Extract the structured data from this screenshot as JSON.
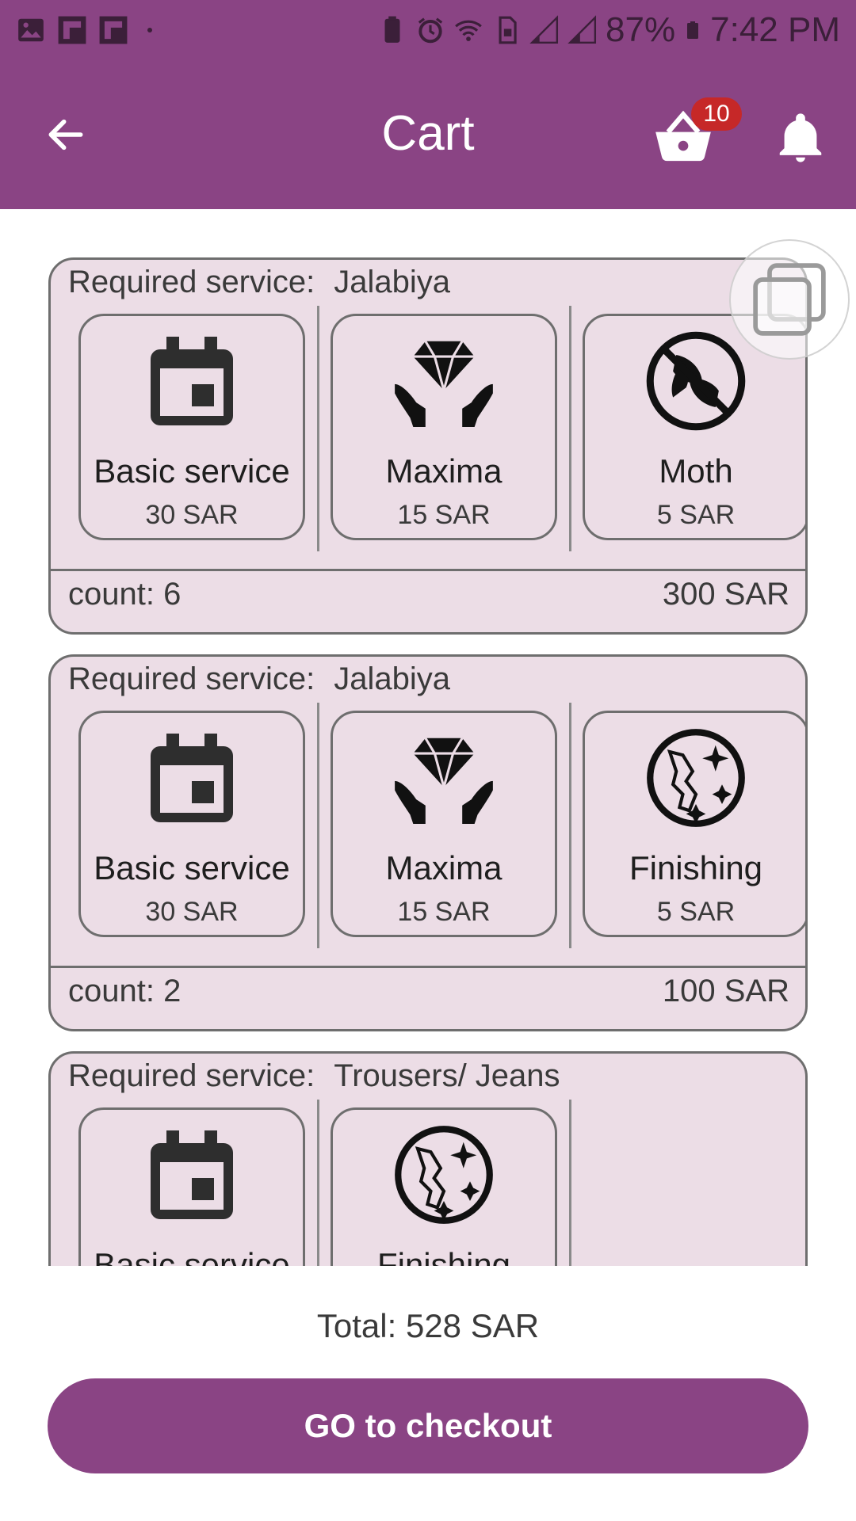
{
  "status_bar": {
    "battery_percent": "87%",
    "time": "7:42 PM"
  },
  "app_bar": {
    "title": "Cart",
    "cart_badge": "10"
  },
  "cart_items": [
    {
      "label": "Required service:",
      "service_name": "Jalabiya",
      "options": [
        {
          "icon": "calendar-icon",
          "name": "Basic service",
          "price": "30 SAR"
        },
        {
          "icon": "diamond-hands-icon",
          "name": "Maxima",
          "price": "15 SAR"
        },
        {
          "icon": "no-moth-icon",
          "name": "Moth",
          "price": "5 SAR"
        }
      ],
      "count": "count: 6",
      "total": "300 SAR"
    },
    {
      "label": "Required service:",
      "service_name": "Jalabiya",
      "options": [
        {
          "icon": "calendar-icon",
          "name": "Basic service",
          "price": "30 SAR"
        },
        {
          "icon": "diamond-hands-icon",
          "name": "Maxima",
          "price": "15 SAR"
        },
        {
          "icon": "sparkle-finishing-icon",
          "name": "Finishing",
          "price": "5 SAR"
        }
      ],
      "count": "count: 2",
      "total": "100 SAR"
    },
    {
      "label": "Required service:",
      "service_name": "Trousers/ Jeans",
      "options": [
        {
          "icon": "calendar-icon",
          "name": "Basic service",
          "price": ""
        },
        {
          "icon": "sparkle-finishing-icon",
          "name": "Finishing",
          "price": ""
        }
      ]
    }
  ],
  "footer": {
    "total": "Total: 528 SAR",
    "checkout_label": "GO to checkout"
  },
  "colors": {
    "primary": "#8a4484",
    "card_bg": "#ecdde6",
    "badge": "#c62828"
  }
}
